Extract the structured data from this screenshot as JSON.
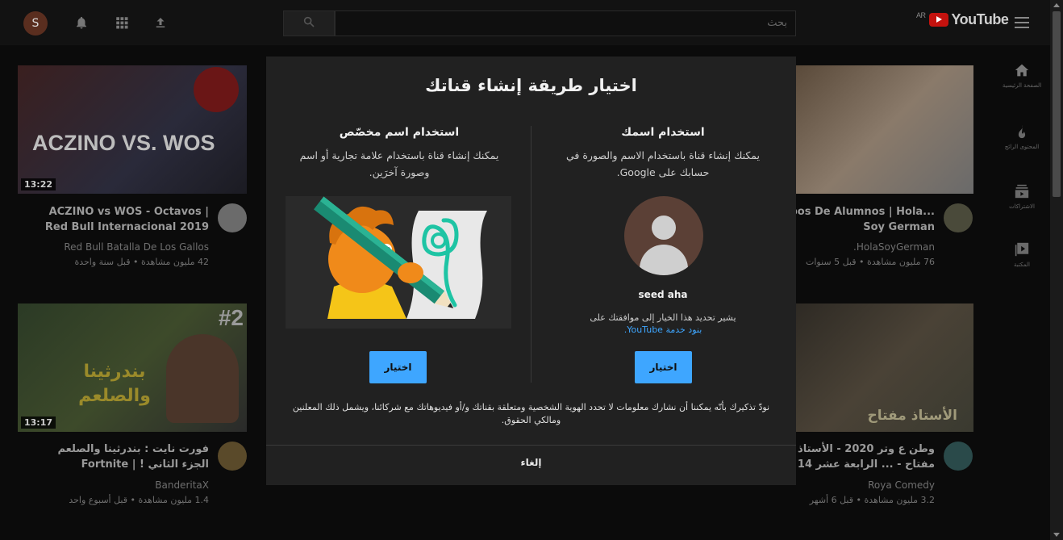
{
  "header": {
    "avatar_letter": "S",
    "search_placeholder": "بحث",
    "logo_region": "AR",
    "logo_text": "YouTube"
  },
  "sidenav": {
    "items": [
      {
        "label": "الصفحة الرئيسية",
        "icon": "home-icon"
      },
      {
        "label": "المحتوى الرائج",
        "icon": "fire-icon"
      },
      {
        "label": "الاشتراكات",
        "icon": "subscriptions-icon"
      },
      {
        "label": "المكتبة",
        "icon": "library-icon"
      }
    ]
  },
  "videos": [
    {
      "duration": "13:22",
      "title": "ACZINO vs WOS - Octavos | Red Bull Internacional 2019",
      "channel": "Red Bull Batalla De Los Gallos",
      "meta": "42 مليون مشاهدة • قبل سنة واحدة",
      "thumb_text": "ACZINO VS. WOS"
    },
    {
      "duration": "13:17",
      "title": "فورت نايت : بندرثينا والصلعم الجزء الثاني ! | Fortnite",
      "channel": "BanderitaX",
      "meta": "1.4 مليون مشاهدة • قبل أسبوع واحد",
      "thumb_text": "بندرثينا والصلعم",
      "badge": "#2"
    },
    {
      "title": "...ipos De Alumnos | Hola Soy German",
      "channel": "HolaSoyGerman.",
      "meta": "76 مليون مشاهدة • قبل 5 سنوات"
    },
    {
      "title": "وطن ع وتر 2020 - الأستاذ مفتاح - ... الرابعة عشر 14",
      "channel": "Roya Comedy",
      "meta": "3.2 مليون مشاهدة • قبل 6 أشهر",
      "thumb_text": "الأستاذ مفتاح"
    }
  ],
  "dialog": {
    "title": "اختيار طريقة إنشاء قناتك",
    "custom": {
      "heading": "استخدام اسم مخصّص",
      "description": "يمكنك إنشاء قناة باستخدام علامة تجارية أو اسم وصورة آخرَين.",
      "button": "اختيار"
    },
    "own": {
      "heading": "استخدام اسمك",
      "description": "يمكنك إنشاء قناة باستخدام الاسم والصورة في حسابك على Google.",
      "user_name": "seed aha",
      "consent_text": "يشير تحديد هذا الخيار إلى موافقتك على",
      "consent_link": "بنود خدمة YouTube.",
      "button": "اختيار"
    },
    "notice": "نودّ تذكيرك بأنّه يمكننا أن نشارك معلومات لا تحدد الهوية الشخصية ومتعلقة بقناتك و/أو فيديوهاتك مع شركائنا، ويشمل ذلك المعلنين ومالكي الحقوق.",
    "cancel": "إلغاء"
  },
  "colors": {
    "dialog_bg": "#212121",
    "accent_button": "#3ea6ff",
    "link": "#3ea6ff",
    "brand_red": "#c4120e"
  }
}
